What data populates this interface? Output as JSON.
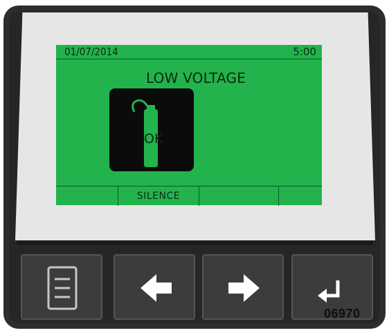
{
  "screen": {
    "date": "01/07/2014",
    "time": "5:00",
    "message": "LOW VOLTAGE",
    "icon": {
      "name": "fire-extinguisher-icon",
      "label": "OK"
    },
    "softkeys": [
      {
        "label": ""
      },
      {
        "label": "SILENCE"
      },
      {
        "label": ""
      },
      {
        "label": ""
      }
    ]
  },
  "buttons": [
    {
      "name": "menu-button",
      "icon": "menu-icon"
    },
    {
      "name": "left-arrow-button",
      "icon": "arrow-left-icon"
    },
    {
      "name": "right-arrow-button",
      "icon": "arrow-right-icon"
    },
    {
      "name": "enter-button",
      "icon": "enter-icon"
    }
  ],
  "figure_code": "06970",
  "colors": {
    "lcd_background": "#23b34c",
    "lcd_text": "#0a2a12",
    "bezel": "#2d2d2d",
    "button": "#3c3c3c"
  }
}
